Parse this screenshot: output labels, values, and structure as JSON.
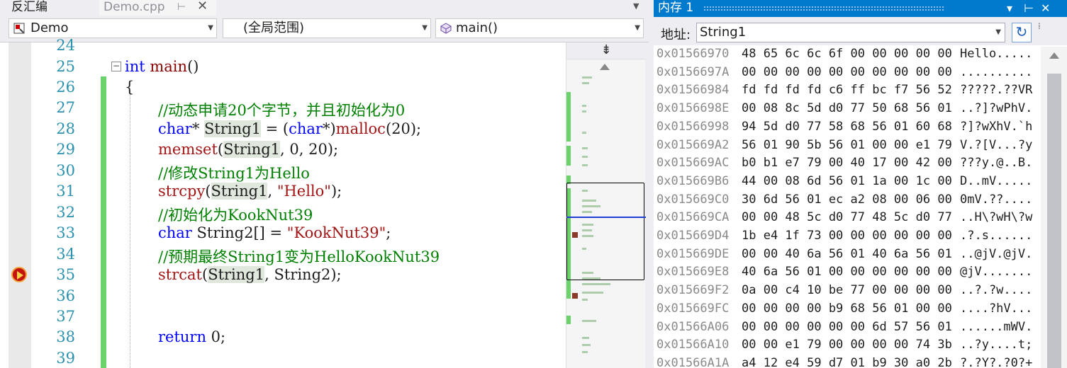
{
  "tabs": {
    "disasm": "反汇编",
    "demo": "Demo.cpp",
    "pin": "⊢",
    "close": "✕",
    "dropdown": "▼"
  },
  "nav": {
    "project": "Demo",
    "scope": "(全局范围)",
    "func": "main()"
  },
  "editor": {
    "lines": [
      {
        "num": "24"
      },
      {
        "num": "25"
      },
      {
        "num": "26"
      },
      {
        "num": "27"
      },
      {
        "num": "28"
      },
      {
        "num": "29"
      },
      {
        "num": "30"
      },
      {
        "num": "31"
      },
      {
        "num": "32"
      },
      {
        "num": "33"
      },
      {
        "num": "34"
      },
      {
        "num": "35"
      },
      {
        "num": "36"
      },
      {
        "num": "37"
      },
      {
        "num": "38"
      },
      {
        "num": "39"
      }
    ],
    "code": {
      "l25_kw": "int",
      "l25_fn": "main",
      "l25_rest": "()",
      "l26": "{",
      "l27": "//动态申请20个字节，并且初始化为0",
      "l28_kw": "char",
      "l28_a": "* ",
      "l28_var": "String1",
      "l28_b": " = (",
      "l28_kw2": "char",
      "l28_c": "*)",
      "l28_fn": "malloc",
      "l28_d": "(20);",
      "l29_fn": "memset",
      "l29_a": "(",
      "l29_var": "String1",
      "l29_b": ", 0, 20);",
      "l30": "//修改String1为Hello",
      "l31_fn": "strcpy",
      "l31_a": "(",
      "l31_var": "String1",
      "l31_b": ", ",
      "l31_str": "\"Hello\"",
      "l31_c": ");",
      "l32": "//初始化为KookNut39",
      "l33_kw": "char",
      "l33_a": " String2[] = ",
      "l33_str": "\"KookNut39\"",
      "l33_b": ";",
      "l34": "//预期最终String1变为HelloKookNut39",
      "l35_fn": "strcat",
      "l35_a": "(",
      "l35_var": "String1",
      "l35_b": ", String2);",
      "l38_kw": "return",
      "l38_a": " 0;"
    }
  },
  "minimap": {
    "split_glyph": "⇟"
  },
  "memory": {
    "title": "内存 1",
    "buttons": {
      "dropdown": "▾",
      "pin": "⊢",
      "close": "✕"
    },
    "address_label": "地址:",
    "address_value": "String1",
    "refresh": "↻",
    "more": "⁞",
    "rows": [
      {
        "addr": "0x01566970",
        "bytes": "48 65 6c 6c 6f 00 00 00 00 00",
        "ascii": "Hello....."
      },
      {
        "addr": "0x0156697A",
        "bytes": "00 00 00 00 00 00 00 00 00 00",
        "ascii": ".........."
      },
      {
        "addr": "0x01566984",
        "bytes": "fd fd fd fd c6 ff bc f7 56 52",
        "ascii": "?????.??VR"
      },
      {
        "addr": "0x0156698E",
        "bytes": "00 08 8c 5d d0 77 50 68 56 01",
        "ascii": "..?]?wPhV."
      },
      {
        "addr": "0x01566998",
        "bytes": "94 5d d0 77 58 68 56 01 60 68",
        "ascii": "?]?wXhV.`h"
      },
      {
        "addr": "0x015669A2",
        "bytes": "56 01 90 5b 56 01 00 00 e1 79",
        "ascii": "V.?[V...?y"
      },
      {
        "addr": "0x015669AC",
        "bytes": "b0 b1 e7 79 00 40 17 00 42 00",
        "ascii": "???y.@..B."
      },
      {
        "addr": "0x015669B6",
        "bytes": "44 00 08 6d 56 01 1a 00 1c 00",
        "ascii": "D..mV....."
      },
      {
        "addr": "0x015669C0",
        "bytes": "30 6d 56 01 ec a2 08 00 06 00",
        "ascii": "0mV.??...."
      },
      {
        "addr": "0x015669CA",
        "bytes": "00 00 48 5c d0 77 48 5c d0 77",
        "ascii": "..H\\?wH\\?w"
      },
      {
        "addr": "0x015669D4",
        "bytes": "1b e4 1f 73 00 00 00 00 00 00",
        "ascii": ".?.s......"
      },
      {
        "addr": "0x015669DE",
        "bytes": "00 00 40 6a 56 01 40 6a 56 01",
        "ascii": "..@jV.@jV."
      },
      {
        "addr": "0x015669E8",
        "bytes": "40 6a 56 01 00 00 00 00 00 00",
        "ascii": "@jV......."
      },
      {
        "addr": "0x015669F2",
        "bytes": "0a 00 c4 10 be 77 00 00 00 00",
        "ascii": "..?.?w...."
      },
      {
        "addr": "0x015669FC",
        "bytes": "00 00 00 00 b9 68 56 01 00 00",
        "ascii": "....?hV..."
      },
      {
        "addr": "0x01566A06",
        "bytes": "00 00 00 00 00 00 6d 57 56 01",
        "ascii": "......mWV."
      },
      {
        "addr": "0x01566A10",
        "bytes": "00 00 e1 79 00 00 00 00 74 3b",
        "ascii": "..?y....t;"
      },
      {
        "addr": "0x01566A1A",
        "bytes": "a4 12 e4 59 d7 01 b9 30 a0 2b",
        "ascii": "?.?Y?.?0?+"
      }
    ]
  }
}
